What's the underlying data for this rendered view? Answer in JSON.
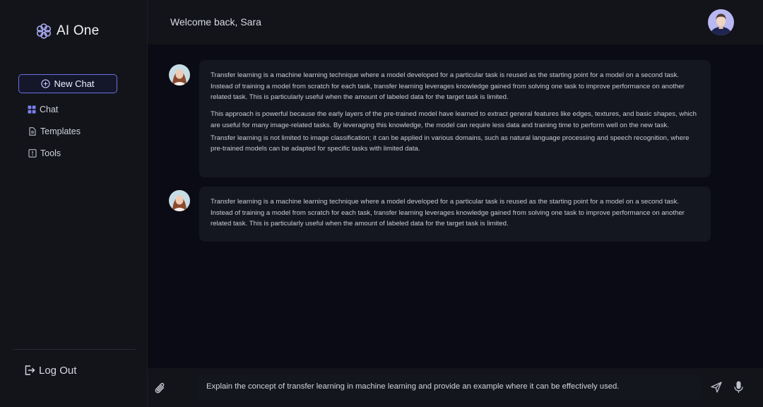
{
  "app": {
    "name": "AI One"
  },
  "sidebar": {
    "new_chat_label": "New Chat",
    "items": [
      {
        "label": "Chat",
        "icon": "grid-icon"
      },
      {
        "label": "Templates",
        "icon": "document-icon"
      },
      {
        "label": "Tools",
        "icon": "tool-icon"
      }
    ],
    "logout_label": "Log Out"
  },
  "header": {
    "welcome": "Welcome back, Sara"
  },
  "messages": [
    {
      "avatar": "user-avatar",
      "paragraphs": [
        "Transfer learning is a machine learning technique where a model developed for a particular task is reused as the starting point for a model on a second task. Instead of training a model from scratch for each task, transfer learning leverages knowledge gained from solving one task to improve performance on another related task. This is particularly useful when the amount of labeled data for the target task is limited.",
        "This approach is powerful because the early layers of the pre-trained model have learned to extract general features like edges, textures, and basic shapes, which are useful for many image-related tasks. By leveraging this knowledge, the model can require less data and training time to perform well on the new task.",
        "Transfer learning is not limited to image classification; it can be applied in various domains, such as natural language processing and speech recognition, where pre-trained models can be adapted for specific tasks with limited data."
      ]
    },
    {
      "avatar": "user-avatar",
      "paragraphs": [
        "Transfer learning is a machine learning technique where a model developed for a particular task is reused as the starting point for a model on a second task. Instead of training a model from scratch for each task, transfer learning leverages knowledge gained from solving one task to improve performance on another related task. This is particularly useful when the amount of labeled data for the target task is limited."
      ]
    }
  ],
  "composer": {
    "value": "Explain the concept of transfer learning in machine learning and provide an example where it can be effectively used."
  },
  "colors": {
    "accent": "#6c6fe0",
    "sidebar_bg": "#121419",
    "main_bg": "#0a0b14",
    "bubble_bg": "#151720"
  }
}
